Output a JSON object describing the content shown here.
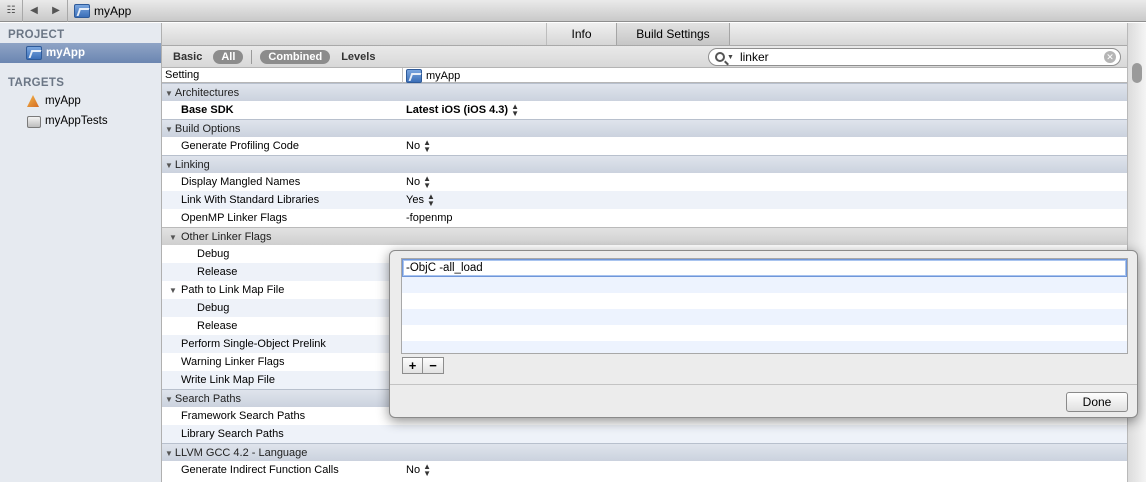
{
  "topbar": {
    "breadcrumb": "myApp"
  },
  "sidebar": {
    "project_header": "PROJECT",
    "project_item": "myApp",
    "targets_header": "TARGETS",
    "targets": [
      "myApp",
      "myAppTests"
    ]
  },
  "tabs": {
    "info": "Info",
    "build_settings": "Build Settings"
  },
  "filters": {
    "basic": "Basic",
    "all": "All",
    "combined": "Combined",
    "levels": "Levels"
  },
  "search": {
    "value": "linker"
  },
  "columns": {
    "setting": "Setting",
    "target": "myApp"
  },
  "rows": {
    "architectures": "Architectures",
    "base_sdk": "Base SDK",
    "base_sdk_val": "Latest iOS (iOS 4.3)",
    "build_options": "Build Options",
    "gen_profiling": "Generate Profiling Code",
    "gen_profiling_val": "No",
    "linking": "Linking",
    "display_mangled": "Display Mangled Names",
    "display_mangled_val": "No",
    "link_std_libs": "Link With Standard Libraries",
    "link_std_libs_val": "Yes",
    "openmp_flags": "OpenMP Linker Flags",
    "openmp_flags_val": "-fopenmp",
    "other_linker_flags": "Other Linker Flags",
    "debug": "Debug",
    "release": "Release",
    "path_link_map": "Path to Link Map File",
    "single_object_prelink": "Perform Single-Object Prelink",
    "warning_linker_flags": "Warning Linker Flags",
    "write_link_map": "Write Link Map File",
    "search_paths": "Search Paths",
    "framework_search": "Framework Search Paths",
    "library_search": "Library Search Paths",
    "llvm_gcc": "LLVM GCC 4.2 - Language",
    "gen_indirect": "Generate Indirect Function Calls",
    "gen_indirect_val": "No"
  },
  "popover": {
    "entry": "-ObjC -all_load",
    "add": "+",
    "remove": "−",
    "done": "Done"
  }
}
